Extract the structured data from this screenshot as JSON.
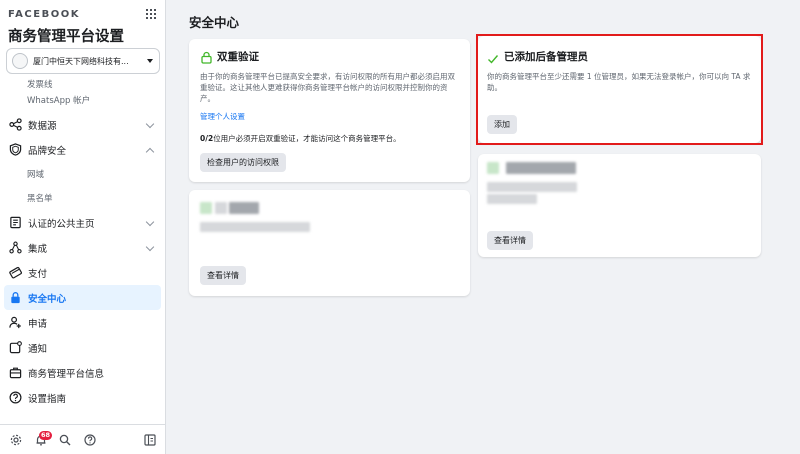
{
  "sidebar": {
    "brand": "FACEBOOK",
    "title": "商务管理平台设置",
    "account_name": "厦门中恒天下网络科技有...",
    "nav": [
      {
        "label": "发票线",
        "type": "sub"
      },
      {
        "label": "WhatsApp 帐户",
        "type": "sub"
      },
      {
        "label": "数据源",
        "icon": "data-sources-icon",
        "chevron": "down"
      },
      {
        "label": "品牌安全",
        "icon": "shield-icon",
        "chevron": "up"
      },
      {
        "label": "网域",
        "type": "sub"
      },
      {
        "label": "黑名单",
        "type": "sub"
      },
      {
        "label": "认证的公共主页",
        "icon": "pages-icon",
        "chevron": "down"
      },
      {
        "label": "集成",
        "icon": "integrations-icon",
        "chevron": "down"
      },
      {
        "label": "支付",
        "icon": "payment-icon"
      },
      {
        "label": "安全中心",
        "icon": "lock-icon",
        "active": true
      },
      {
        "label": "申请",
        "icon": "requests-icon"
      },
      {
        "label": "通知",
        "icon": "notifications-icon"
      },
      {
        "label": "商务管理平台信息",
        "icon": "business-info-icon"
      },
      {
        "label": "设置指南",
        "icon": "help-icon"
      }
    ],
    "footer": {
      "notification_count": "68"
    }
  },
  "main": {
    "page_title": "安全中心",
    "two_factor": {
      "title": "双重验证",
      "description": "由于你的商务管理平台已提高安全要求，有访问权限的所有用户都必须启用双重验证。这让其他人更难获得你商务管理平台帐户的访问权限并控制你的资产。",
      "link": "管理个人设置",
      "status_count": "0/2",
      "status_text": "位用户必须开启双重验证，才能访问这个商务管理平台。",
      "button": "检查用户的访问权限"
    },
    "backup_admin": {
      "title": "已添加后备管理员",
      "description": "你的商务管理平台至少还需要 1 位管理员，如果无法登录帐户，你可以向 TA 求助。",
      "button": "添加"
    },
    "card_left_bottom": {
      "button": "查看详情"
    },
    "card_right_bottom": {
      "button": "查看详情"
    },
    "colors": {
      "accent": "#1877f2",
      "highlight": "#e21b1b",
      "success": "#42b72a"
    }
  }
}
